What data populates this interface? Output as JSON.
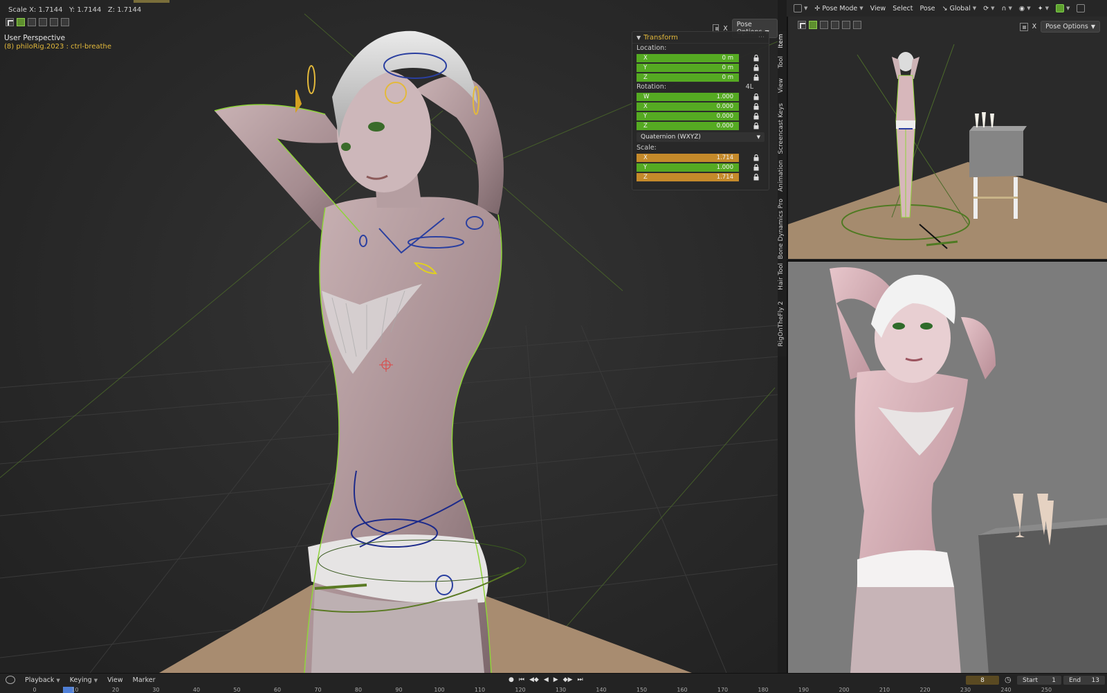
{
  "status": {
    "scale_readout": "Scale X: 1.7144   Y: 1.7144   Z: 1.7144"
  },
  "viewport_main": {
    "title": "User Perspective",
    "subtitle": "(8) philoRig.2023 : ctrl-breathe",
    "pose_options": "Pose Options",
    "xray_label": "X"
  },
  "transform_panel": {
    "title": "Transform",
    "location_label": "Location:",
    "location": [
      {
        "axis": "X",
        "value": "0 m"
      },
      {
        "axis": "Y",
        "value": "0 m"
      },
      {
        "axis": "Z",
        "value": "0 m"
      }
    ],
    "rotation_label": "Rotation:",
    "rotation_flag": "4L",
    "rotation": [
      {
        "axis": "W",
        "value": "1.000"
      },
      {
        "axis": "X",
        "value": "0.000"
      },
      {
        "axis": "Y",
        "value": "0.000"
      },
      {
        "axis": "Z",
        "value": "0.000"
      }
    ],
    "rotation_mode": "Quaternion (WXYZ)",
    "scale_label": "Scale:",
    "scale": [
      {
        "axis": "X",
        "value": "1.714"
      },
      {
        "axis": "Y",
        "value": "1.000"
      },
      {
        "axis": "Z",
        "value": "1.714"
      }
    ]
  },
  "side_tabs": [
    "Item",
    "Tool",
    "View",
    "Screencast Keys",
    "Animation",
    "Bone Dynamics Pro",
    "Hair Tool",
    "RigOnTheFly 2"
  ],
  "right_header": {
    "mode": "Pose Mode",
    "menus": [
      "View",
      "Select",
      "Pose"
    ],
    "orientation": "Global"
  },
  "viewport_top": {
    "pose_options": "Pose Options",
    "xray_label": "X"
  },
  "timeline": {
    "menus": [
      "Playback",
      "Keying",
      "View",
      "Marker"
    ],
    "current_frame": "8",
    "start_label": "Start",
    "start_value": "1",
    "end_label": "End",
    "end_value": "13",
    "ruler": [
      "0",
      "10",
      "20",
      "30",
      "40",
      "50",
      "60",
      "70",
      "80",
      "90",
      "100",
      "110",
      "120",
      "130",
      "140",
      "150",
      "160",
      "170",
      "180",
      "190",
      "200",
      "210",
      "220",
      "230",
      "240",
      "250"
    ]
  },
  "colors": {
    "field_green": "#55aa22",
    "field_orange": "#c58a2a",
    "accent_yellow": "#e3b93b",
    "selection_outline": "#8fd43a"
  }
}
